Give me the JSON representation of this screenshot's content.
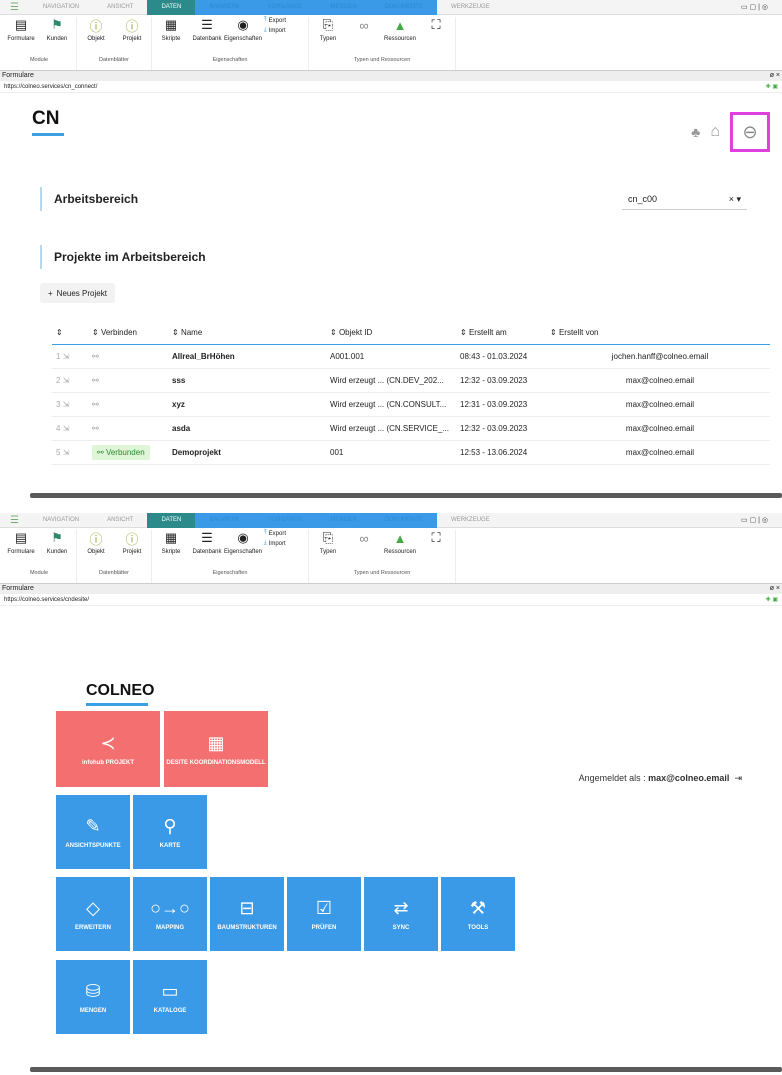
{
  "tabs": [
    "NAVIGATION",
    "ANSICHT",
    "DATEN",
    "BAUWERK",
    "VORGÄNGE",
    "MENGEN",
    "DOKUMENTE",
    "WERKZEUGE"
  ],
  "ribbon": {
    "formulare": "Formulare",
    "kunden": "Kunden",
    "objekt": "Objekt",
    "projekt": "Projekt",
    "skripte": "Skripte",
    "datenbank": "Datenbank",
    "eigenschaften": "Eigenschaften",
    "export": "Export",
    "import": "Import",
    "typen": "Typen",
    "ressourcen": "Ressourcen",
    "g_module": "Module",
    "g_datenblaetter": "Datenblätter",
    "g_eigenschaften": "Eigenschaften",
    "g_typen": "Typen und Ressourcen"
  },
  "window_title": "Formulare",
  "top": {
    "url": "https://colneo.services/cn_connect/",
    "logo": "CN",
    "workspace_label": "Arbeitsbereich",
    "workspace_value": "cn_c00",
    "projects_label": "Projekte im Arbeitsbereich",
    "new_project": "Neues Projekt",
    "columns": [
      "Verbinden",
      "Name",
      "Objekt ID",
      "Erstellt am",
      "Erstellt von"
    ],
    "rows": [
      {
        "i": "1",
        "name": "Allreal_BrHöhen",
        "id": "A001.001",
        "date": "08:43 - 01.03.2024",
        "by": "jochen.hanff@colneo.email",
        "connected": ""
      },
      {
        "i": "2",
        "name": "sss",
        "id": "Wird erzeugt ... (CN.DEV_202...",
        "date": "12:32 - 03.09.2023",
        "by": "max@colneo.email",
        "connected": ""
      },
      {
        "i": "3",
        "name": "xyz",
        "id": "Wird erzeugt ... (CN.CONSULT...",
        "date": "12:31 - 03.09.2023",
        "by": "max@colneo.email",
        "connected": ""
      },
      {
        "i": "4",
        "name": "asda",
        "id": "Wird erzeugt ... (CN.SERVICE_...",
        "date": "12:32 - 03.09.2023",
        "by": "max@colneo.email",
        "connected": ""
      },
      {
        "i": "5",
        "name": "Demoprojekt",
        "id": "001",
        "date": "12:53 - 13.06.2024",
        "by": "max@colneo.email",
        "connected": "Verbunden"
      }
    ]
  },
  "bottom": {
    "url": "https://colneo.services/cndesite/",
    "logo": "COLNEO",
    "user_prefix": "Angemeldet als : ",
    "user": "max@colneo.email",
    "tiles": [
      "infohub PROJEKT",
      "DESITE KOORDINATIONSMODELL",
      "ANSICHTSPUNKTE",
      "KARTE",
      "ERWEITERN",
      "MAPPING",
      "BAUMSTRUKTUREN",
      "PRÜFEN",
      "SYNC",
      "TOOLS",
      "MENGEN",
      "KATALOGE"
    ]
  },
  "colors": {
    "accent": "#3aa0e0",
    "tab_active": "#2d8a8a",
    "tile_red": "#f47070",
    "tile_blue": "#3a9ae8",
    "highlight": "#e040e0"
  }
}
